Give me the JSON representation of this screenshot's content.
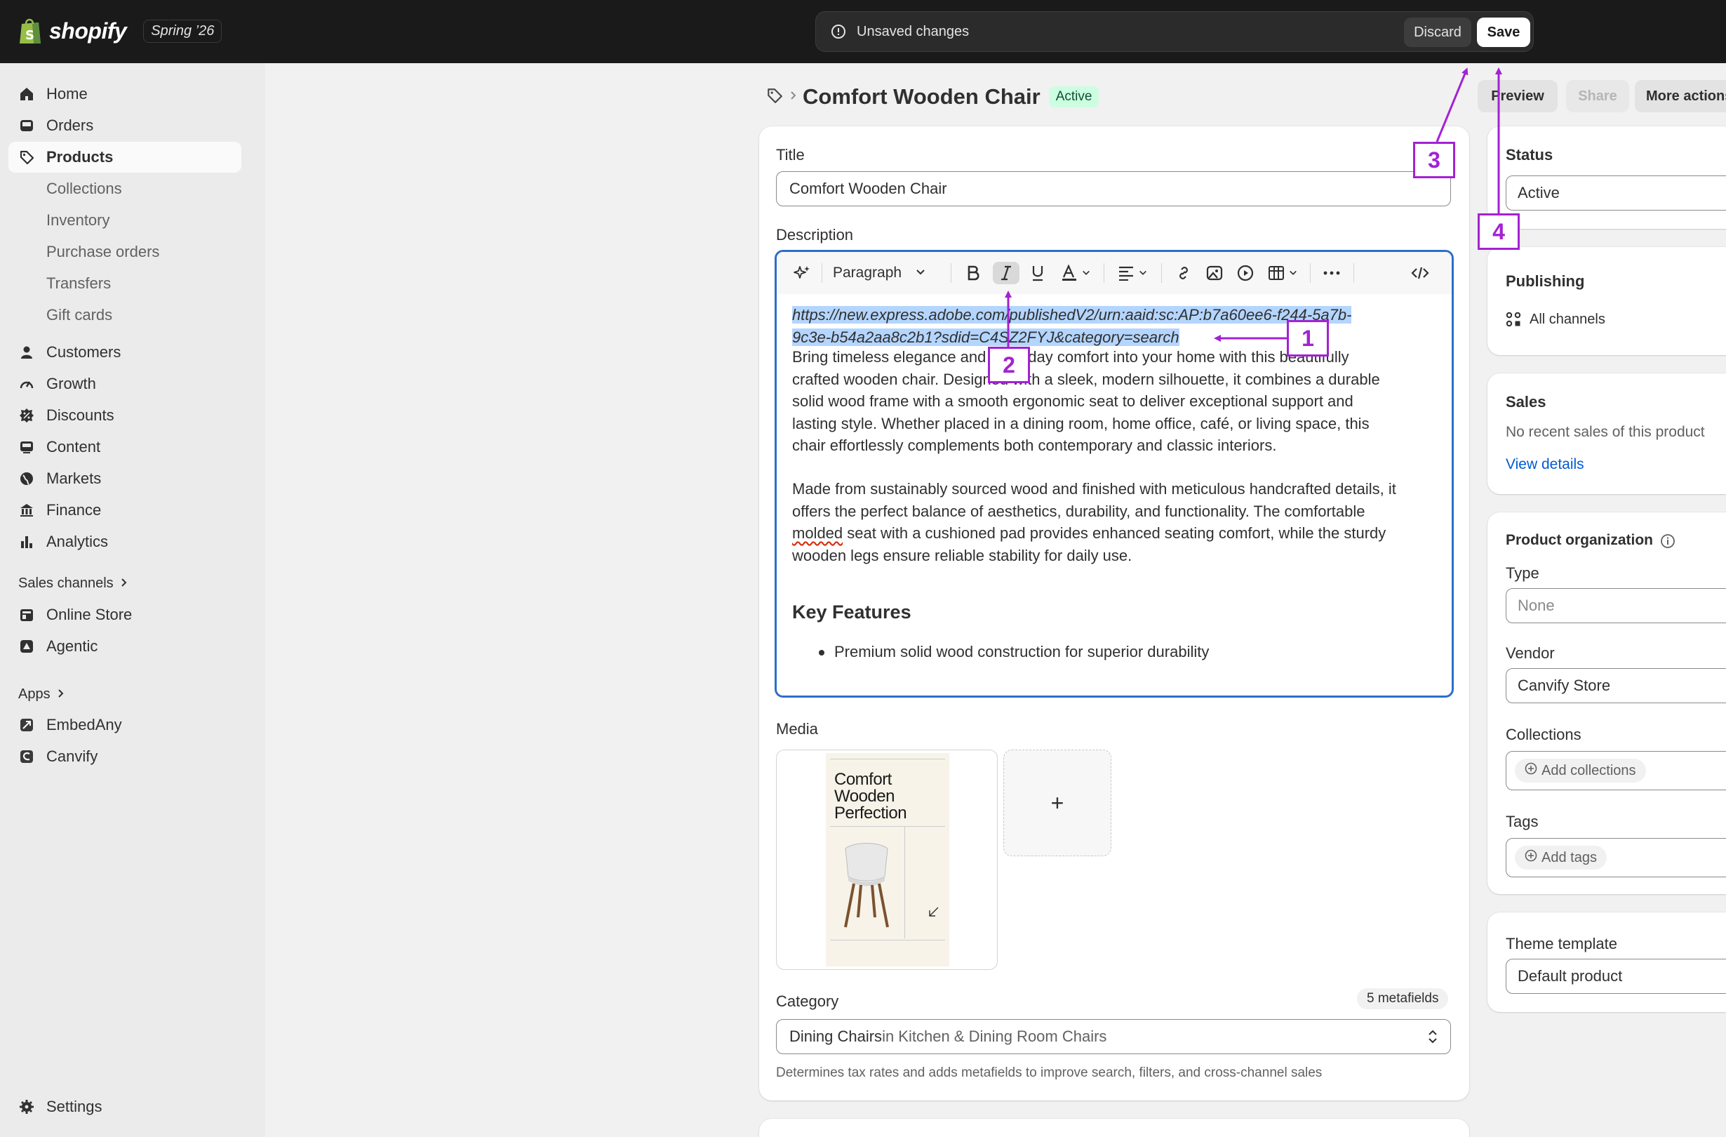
{
  "topbar": {
    "brand": "shopify",
    "edition": "Spring ’26",
    "unsaved_message": "Unsaved changes",
    "discard_label": "Discard",
    "save_label": "Save"
  },
  "sidebar": {
    "items": [
      {
        "label": "Home",
        "icon": "home-icon"
      },
      {
        "label": "Orders",
        "icon": "inbox-icon"
      },
      {
        "label": "Products",
        "icon": "tag-icon",
        "active": true
      },
      {
        "label": "Collections",
        "sub": true
      },
      {
        "label": "Inventory",
        "sub": true
      },
      {
        "label": "Purchase orders",
        "sub": true
      },
      {
        "label": "Transfers",
        "sub": true
      },
      {
        "label": "Gift cards",
        "sub": true
      },
      {
        "label": "Customers",
        "icon": "person-icon"
      },
      {
        "label": "Growth",
        "icon": "gauge-icon"
      },
      {
        "label": "Discounts",
        "icon": "discount-icon"
      },
      {
        "label": "Content",
        "icon": "content-icon"
      },
      {
        "label": "Markets",
        "icon": "globe-icon"
      },
      {
        "label": "Finance",
        "icon": "bank-icon"
      },
      {
        "label": "Analytics",
        "icon": "bar-chart-icon"
      }
    ],
    "sales_channels_title": "Sales channels",
    "sales_channels": [
      {
        "label": "Online Store",
        "icon": "store-icon"
      },
      {
        "label": "Agentic",
        "icon": "agentic-icon"
      }
    ],
    "apps_title": "Apps",
    "apps": [
      {
        "label": "EmbedAny",
        "icon": "embedany-icon"
      },
      {
        "label": "Canvify",
        "icon": "canvify-icon"
      }
    ],
    "settings_label": "Settings"
  },
  "header": {
    "title": "Comfort Wooden Chair",
    "status_badge": "Active",
    "preview_label": "Preview",
    "share_label": "Share",
    "more_actions_label": "More actions"
  },
  "main": {
    "title_label": "Title",
    "title_value": "Comfort Wooden Chair",
    "description_label": "Description",
    "toolbar": {
      "paragraph_label": "Paragraph"
    },
    "description": {
      "link_line1": "https://new.express.adobe.com/publishedV2/urn:aaid:sc:AP:b7a60ee6-f244-5a7b-",
      "link_line2": "9c3e-b54a2aa8c2b1?sdid=C4SZ2FYJ&category=search",
      "p1_lines": [
        "Bring timeless elegance and everyday comfort into your home with this beautifully",
        "crafted wooden chair. Designed with a sleek, modern silhouette, it combines a durable",
        "solid wood frame with a smooth ergonomic seat to deliver exceptional support and",
        "lasting style. Whether placed in a dining room, home office, café, or living space, this",
        "chair effortlessly complements both contemporary and classic interiors."
      ],
      "p2_line1": "Made from sustainably sourced wood and finished with meticulous handcrafted details, it",
      "p2_line2": "offers the perfect balance of aesthetics, durability, and functionality. The comfortable",
      "p2_line3_word": "molded",
      "p2_line3_rest": " seat with a cushioned pad provides enhanced seating comfort, while the sturdy",
      "p2_line4": "wooden legs ensure reliable stability for daily use.",
      "heading": "Key Features",
      "bullet1": "Premium solid wood construction for superior durability"
    },
    "media_label": "Media",
    "media_add": "+",
    "poster": {
      "title_line1": "Comfort",
      "title_line2": "Wooden",
      "title_line3": "Perfection"
    },
    "category_label": "Category",
    "metafields_badge": "5 metafields",
    "category_value": "Dining Chairs",
    "category_in": " in Kitchen & Dining Room Chairs",
    "category_help": "Determines tax rates and adds metafields to improve search, filters, and cross-channel sales"
  },
  "right": {
    "status_title": "Status",
    "status_value": "Active",
    "publishing_title": "Publishing",
    "all_channels": "All channels",
    "sales_title": "Sales",
    "sales_empty": "No recent sales of this product",
    "view_details": "View details",
    "org_title": "Product organization",
    "type_label": "Type",
    "type_placeholder": "None",
    "vendor_label": "Vendor",
    "vendor_value": "Canvify Store",
    "collections_label": "Collections",
    "add_collections": "Add collections",
    "tags_label": "Tags",
    "add_tags": "Add tags",
    "theme_label": "Theme template",
    "theme_value": "Default product"
  },
  "annotations": {
    "a1": "1",
    "a2": "2",
    "a3": "3",
    "a4": "4",
    "color": "#a322d4"
  },
  "colors": {
    "topbar": "#1a1a1a",
    "focus": "#2c6ecb",
    "selection": "#b4d5fe",
    "link": "#005bd3",
    "badge_bg": "#cdfee1",
    "badge_text": "#0c5132"
  }
}
